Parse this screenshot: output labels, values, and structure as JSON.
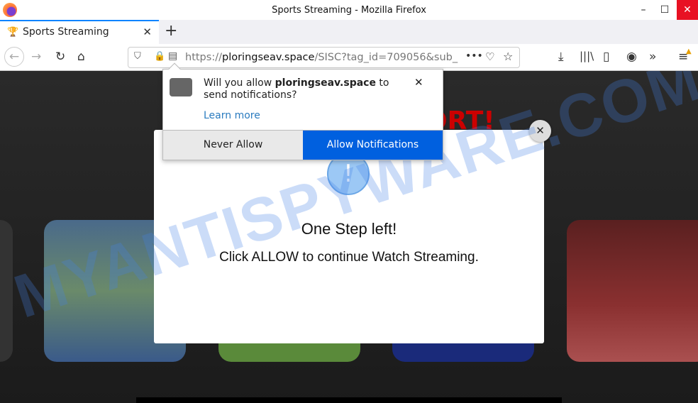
{
  "window": {
    "title": "Sports Streaming - Mozilla Firefox"
  },
  "tab": {
    "label": "Sports Streaming",
    "icon": "trophy-icon"
  },
  "urlbar": {
    "scheme": "https://",
    "domain": "ploringseav.space",
    "path": "/SISC?tag_id=709056&sub_"
  },
  "permission_popup": {
    "prefix": "Will you allow ",
    "domain": "ploringseav.space",
    "suffix": " to send notifications?",
    "learn_more": "Learn more",
    "never_allow": "Never Allow",
    "allow": "Allow Notifications"
  },
  "page": {
    "headline": "ORT!",
    "modal_title": "One Step left!",
    "modal_text": "Click ALLOW to continue Watch Streaming.",
    "modal_icon": "exclamation-icon"
  },
  "watermark": "MYANTISPYWARE.COM",
  "colors": {
    "allow_button": "#0060df",
    "close_window": "#e81123",
    "headline": "#cc0000"
  }
}
